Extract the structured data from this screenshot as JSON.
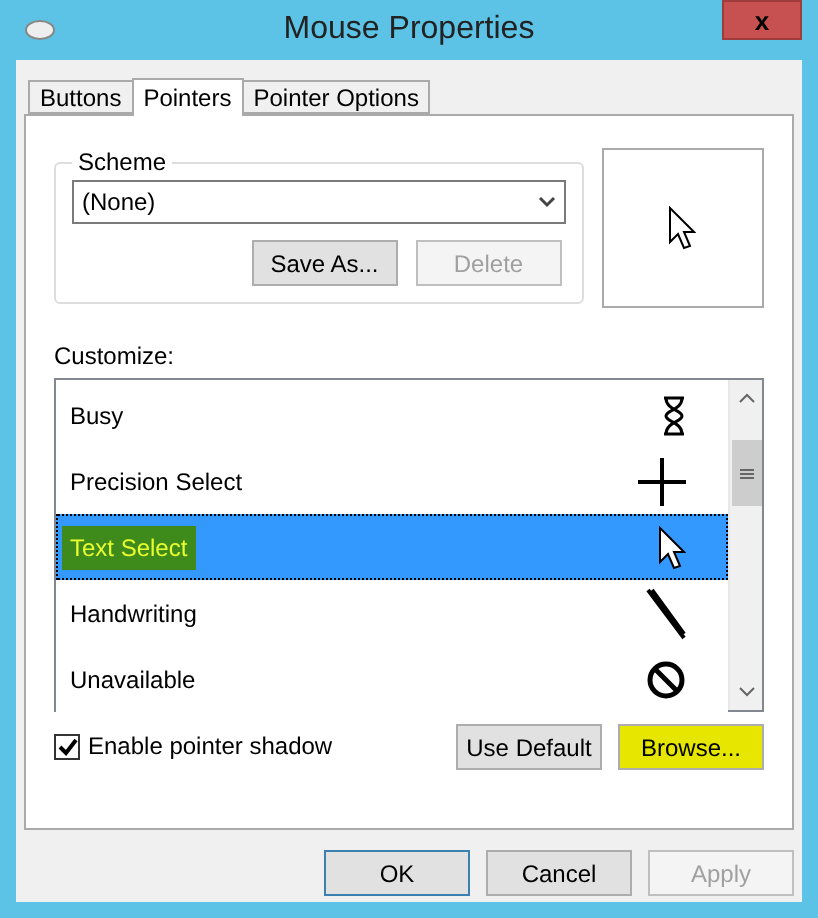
{
  "window": {
    "title": "Mouse Properties",
    "close": "x"
  },
  "tabs": [
    {
      "label": "Buttons",
      "selected": false
    },
    {
      "label": "Pointers",
      "selected": true
    },
    {
      "label": "Pointer Options",
      "selected": false
    }
  ],
  "scheme": {
    "label": "Scheme",
    "value": "(None)",
    "buttons": [
      {
        "label": "Save As...",
        "disabled": false
      },
      {
        "label": "Delete",
        "disabled": true
      }
    ]
  },
  "customize": {
    "label": "Customize:",
    "items": [
      {
        "name": "Busy",
        "kind": "hourglass",
        "selected": false,
        "highlighted": false
      },
      {
        "name": "Precision Select",
        "kind": "crosshair",
        "selected": false,
        "highlighted": false
      },
      {
        "name": "Text Select",
        "kind": "arrow",
        "selected": true,
        "highlighted": true
      },
      {
        "name": "Handwriting",
        "kind": "pen",
        "selected": false,
        "highlighted": false
      },
      {
        "name": "Unavailable",
        "kind": "no",
        "selected": false,
        "highlighted": false
      }
    ]
  },
  "shadow": {
    "label": "Enable pointer shadow",
    "checked": true
  },
  "actions": [
    {
      "label": "Use Default",
      "highlighted": false
    },
    {
      "label": "Browse...",
      "highlighted": true
    }
  ],
  "footer": [
    {
      "label": "OK",
      "disabled": false,
      "default": true
    },
    {
      "label": "Cancel",
      "disabled": false,
      "default": false
    },
    {
      "label": "Apply",
      "disabled": true,
      "default": false
    }
  ]
}
